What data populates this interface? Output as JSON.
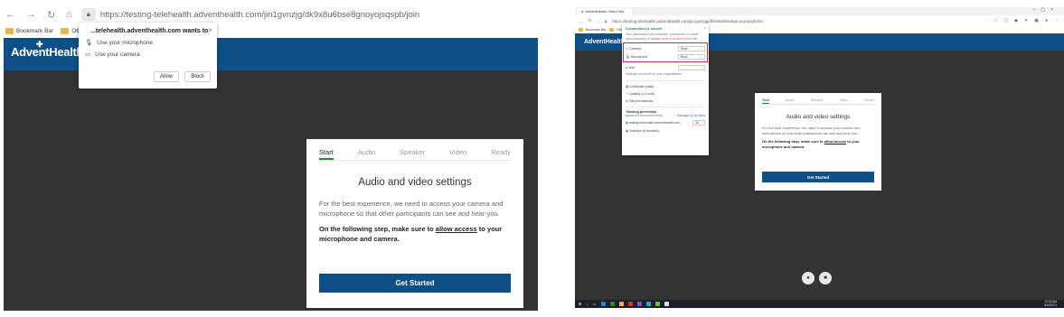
{
  "left": {
    "address_url": "https://testing-telehealth.adventhealth.com/jin1gvnzjg/dk9x8u6bse8gnoyojsqspb/join",
    "bookmarks": [
      "Bookmark Bar",
      "Other f"
    ],
    "logo": "AdventHealth",
    "popup": {
      "title": "...telehealth.adventhealth.com wants to",
      "items": [
        "Use your microphone",
        "Use your camera"
      ],
      "allow": "Allow",
      "block": "Block",
      "close": "×"
    },
    "card": {
      "steps": [
        "Start",
        "Audio",
        "Speaker",
        "Video",
        "Ready"
      ],
      "title": "Audio and video settings",
      "description": "For the best experience, we need to access your camera and microphone so that other participants can see and hear you.",
      "next_prefix": "On the following step, make sure to ",
      "next_link": "allow access",
      "next_suffix": " to your microphone and camera.",
      "button": "Get Started"
    }
  },
  "right": {
    "tab_title": "AdventHealth Video Visi",
    "address_url": "https://testing-telehealth.adventhealth.com/jin1gvnzjg/dk9x8u6bse8gnoyojsqspb/join",
    "bookmarks": [
      "Bookmark Bar",
      "Other"
    ],
    "logo": "AdventHealth",
    "popup": {
      "header": "Connection is secure",
      "subtext": "Your information (for example, passwords or credit card numbers) is private when it is sent to this site.",
      "permissions": [
        {
          "label": "Camera",
          "value": "Block"
        },
        {
          "label": "Microphone",
          "value": "Block"
        }
      ],
      "text_label": "Text",
      "text_sub": "Settings not block for your organization",
      "links": [
        "Certificate (valid)",
        "Cookies (1 in use)",
        "Site permissions"
      ],
      "tracking_title": "Tracking prevention",
      "tracking_left": "Balanced (recommended)",
      "tracking_right": "Manage for all sites",
      "tracking_site": "testing-telehealth.adventhealth.com",
      "tracking_site_value": "On",
      "trackers": "Trackers (0 blocked)",
      "close": "×"
    },
    "card": {
      "steps": [
        "Start",
        "Audio",
        "Speaker",
        "Video",
        "Ready"
      ],
      "title": "Audio and video settings",
      "description": "For the best experience, we need to access your camera and microphone so that other participants can see and hear you.",
      "next_prefix": "On the following step, make sure to ",
      "next_link": "allow access",
      "next_suffix": " to your microphone and camera.",
      "button": "Get Started"
    },
    "clock": {
      "time": "10:53 AM",
      "date": "3/24/2021"
    }
  },
  "colors": {
    "brand": "#0d4f86",
    "accent": "#1c8b3b",
    "dark_bg": "#333333",
    "highlight": "#d62f2f"
  }
}
